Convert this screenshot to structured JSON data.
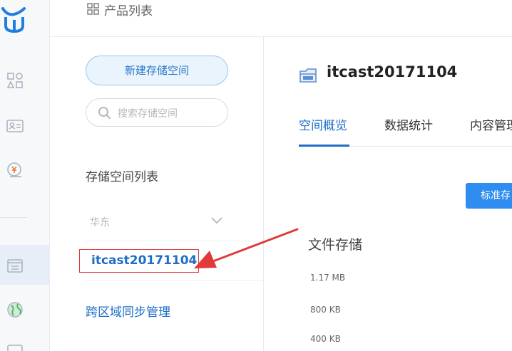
{
  "colors": {
    "accent": "#1c6ec7",
    "button": "#2f8cf0",
    "highlight_box": "#e03a3a",
    "arrow": "#e03a3a"
  },
  "rail": {
    "icons": [
      "qiniu-logo-icon",
      "apps-icon",
      "id-card-icon",
      "finance-icon",
      "storage-icon",
      "globe-icon"
    ],
    "active": "storage-icon"
  },
  "header": {
    "breadcrumb": "产品列表",
    "icon": "grid-icon"
  },
  "sidebar": {
    "new_bucket_label": "新建存储空间",
    "search_placeholder": "搜索存储空间",
    "list_title": "存储空间列表",
    "region_label": "华东",
    "bucket_name": "itcast20171104",
    "cross_region_sync": "跨区域同步管理"
  },
  "main": {
    "bucket_title": "itcast20171104",
    "tabs": [
      "空间概览",
      "数据统计",
      "内容管理"
    ],
    "active_tab": 0,
    "standard_button": "标准存",
    "section_title": "文件存储",
    "y_ticks": [
      "1.17 MB",
      "800 KB",
      "400 KB"
    ]
  }
}
